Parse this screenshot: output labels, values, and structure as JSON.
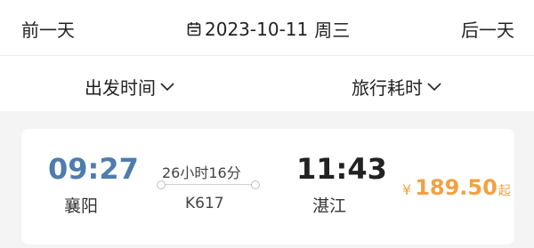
{
  "date_nav": {
    "prev_label": "前一天",
    "date": "2023-10-11",
    "weekday": "周三",
    "next_label": "后一天",
    "calendar_icon": "calendar-icon"
  },
  "sort": {
    "depart_time_label": "出发时间",
    "duration_label": "旅行耗时",
    "chevron_icon": "chevron-down-icon"
  },
  "trains": [
    {
      "depart_time": "09:27",
      "depart_city": "襄阳",
      "duration": "26小时16分",
      "train_no": "K617",
      "arrive_time": "11:43",
      "arrive_city": "湛江",
      "currency": "¥",
      "price": "189.50",
      "price_suffix": "起"
    }
  ],
  "colors": {
    "depart_time": "#4f7cac",
    "price": "#f0a244"
  }
}
